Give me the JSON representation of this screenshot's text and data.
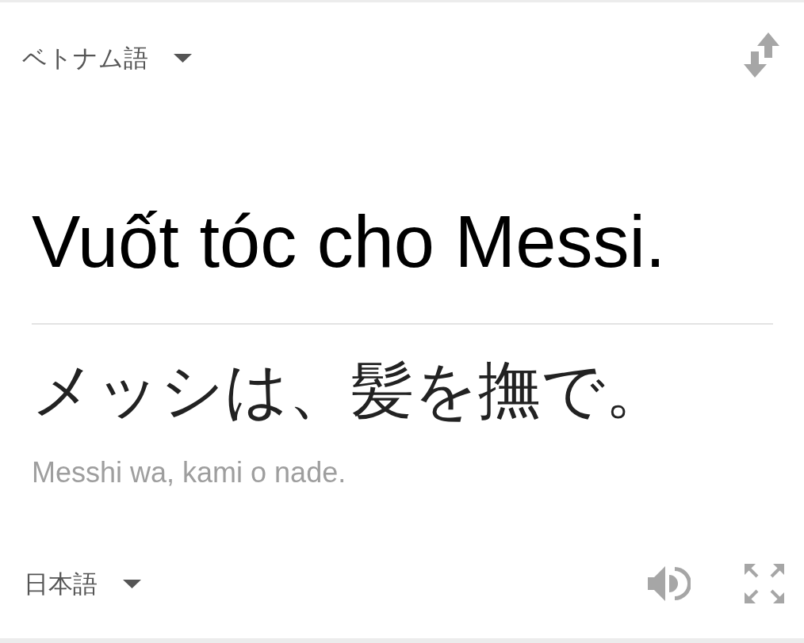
{
  "source_language": {
    "label": "ベトナム語"
  },
  "source_text": "Vuốt tóc cho Messi.",
  "translation": {
    "text": "メッシは、髪を撫で。",
    "romanization": "Messhi wa, kami o nade."
  },
  "target_language": {
    "label": "日本語"
  }
}
